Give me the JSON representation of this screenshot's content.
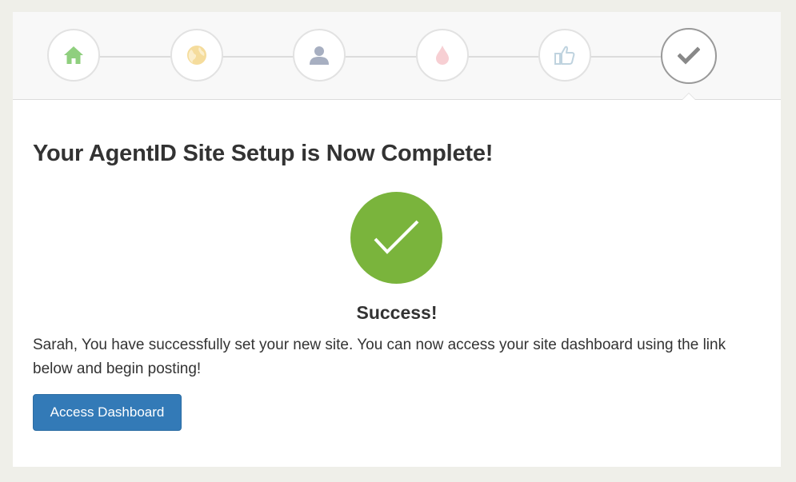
{
  "wizard": {
    "steps": [
      {
        "icon": "home-icon",
        "color": "#8fcf7e"
      },
      {
        "icon": "globe-icon",
        "color": "#f5dc9c"
      },
      {
        "icon": "user-icon",
        "color": "#a7afc1"
      },
      {
        "icon": "drop-icon",
        "color": "#f7cfd3"
      },
      {
        "icon": "thumbs-up-icon",
        "color": "#bfd3df"
      },
      {
        "icon": "check-icon",
        "color": "#888888",
        "active": true
      }
    ]
  },
  "main": {
    "title": "Your AgentID Site Setup is Now Complete!",
    "success_heading": "Success!",
    "message": "Sarah, You have successfully set your new site. You can now access your site dashboard using the link below and begin posting!",
    "button_label": "Access Dashboard"
  },
  "colors": {
    "success_green": "#7ab43c",
    "button_blue": "#337ab7"
  }
}
